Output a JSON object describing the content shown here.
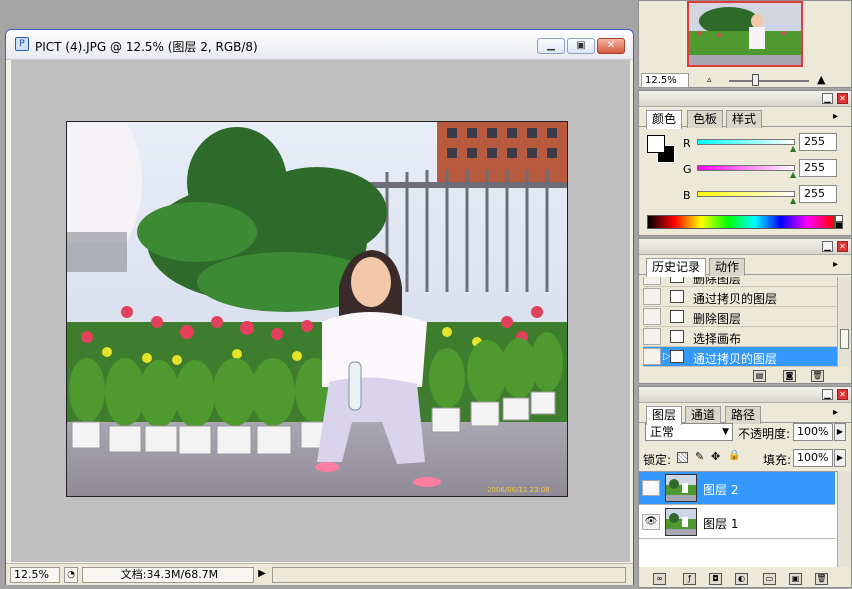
{
  "document": {
    "title": "PICT (4).JPG @ 12.5% (图层 2, RGB/8)",
    "zoom": "12.5%",
    "doc_size": "文档:34.3M/68.7M",
    "photo_timestamp": "2006/06/11 23:08"
  },
  "navigator": {
    "zoom": "12.5%"
  },
  "color_palette": {
    "tabs": [
      "颜色",
      "色板",
      "样式"
    ],
    "channels": [
      {
        "label": "R",
        "value": "255"
      },
      {
        "label": "G",
        "value": "255"
      },
      {
        "label": "B",
        "value": "255"
      }
    ]
  },
  "history_palette": {
    "tabs": [
      "历史记录",
      "动作"
    ],
    "items": [
      "删除图层",
      "通过拷贝的图层",
      "删除图层",
      "选择画布",
      "通过拷贝的图层"
    ],
    "selected_index": 4
  },
  "layers_palette": {
    "tabs": [
      "图层",
      "通道",
      "路径"
    ],
    "blend_mode": "正常",
    "opacity_label": "不透明度:",
    "opacity": "100%",
    "lock_label": "锁定:",
    "fill_label": "填充:",
    "fill": "100%",
    "layers": [
      {
        "name": "图层 2",
        "selected": true
      },
      {
        "name": "图层 1",
        "selected": false
      }
    ]
  },
  "colors": {
    "accent": "#3399ff",
    "title_close": "#d45a3c"
  }
}
